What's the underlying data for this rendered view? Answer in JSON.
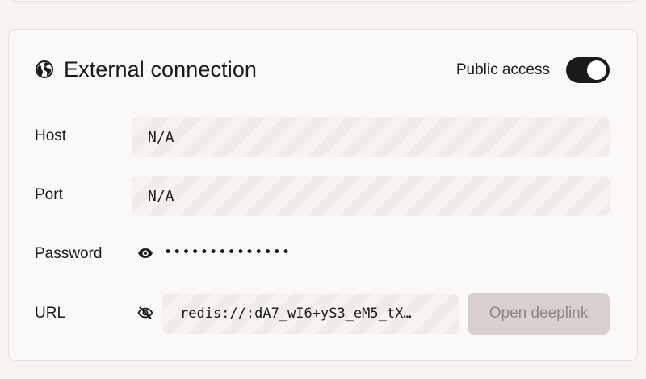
{
  "connection": {
    "title": "External connection",
    "icon": "globe-icon",
    "public_access": {
      "label": "Public access",
      "enabled": true
    }
  },
  "fields": {
    "host": {
      "label": "Host",
      "value": "N/A"
    },
    "port": {
      "label": "Port",
      "value": "N/A"
    },
    "password": {
      "label": "Password",
      "masked_value": "••••••••••••••",
      "icon": "eye-icon"
    },
    "url": {
      "label": "URL",
      "value": "redis://:dA7_wI6+yS3_eM5_tX…",
      "icon": "eye-off-icon"
    }
  },
  "actions": {
    "open_deeplink": "Open deeplink"
  },
  "colors": {
    "toggle_on": "#1b1a19",
    "disabled_button_bg": "#d8d0cd",
    "disabled_button_text": "#8f8582"
  }
}
